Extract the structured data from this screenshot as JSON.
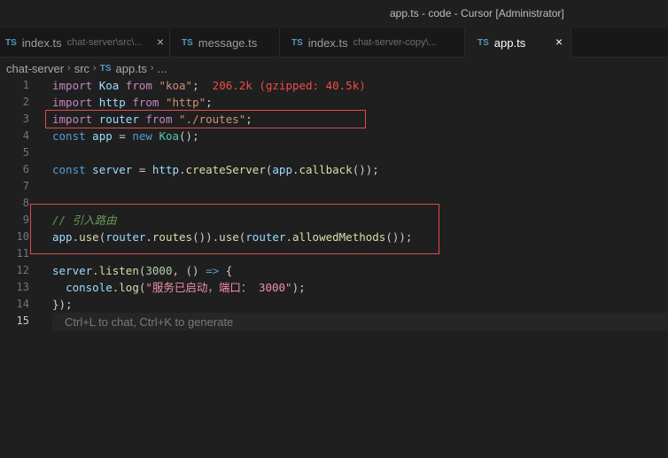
{
  "window": {
    "title": "app.ts - code - Cursor [Administrator]"
  },
  "tabs": [
    {
      "lang": "TS",
      "name": "index.ts",
      "hint": "chat-server\\src\\...",
      "close": "×",
      "active": false
    },
    {
      "lang": "TS",
      "name": "message.ts",
      "hint": "",
      "close": "",
      "active": false
    },
    {
      "lang": "TS",
      "name": "index.ts",
      "hint": "chat-server-copy\\...",
      "close": "",
      "active": false
    },
    {
      "lang": "TS",
      "name": "app.ts",
      "hint": "",
      "close": "×",
      "active": true
    }
  ],
  "breadcrumb": {
    "folder1": "chat-server",
    "folder2": "src",
    "lang": "TS",
    "file": "app.ts",
    "more": "...",
    "sep": "›"
  },
  "lines": [
    "1",
    "2",
    "3",
    "4",
    "5",
    "6",
    "7",
    "8",
    "9",
    "10",
    "11",
    "12",
    "13",
    "14",
    "15"
  ],
  "code": {
    "l1": {
      "kw": "import",
      "name": "Koa",
      "from": "from",
      "str": "\"koa\"",
      "semi": ";",
      "size": "206.2k (gzipped: 40.5k)"
    },
    "l2": {
      "kw": "import",
      "name": "http",
      "from": "from",
      "str": "\"http\"",
      "semi": ";"
    },
    "l3": {
      "kw": "import",
      "name": "router",
      "from": "from",
      "str": "\"./routes\"",
      "semi": ";"
    },
    "l4": {
      "kw": "const",
      "name": "app",
      "eq": " = ",
      "new": "new",
      "cls": "Koa",
      "rest": "();"
    },
    "l6": {
      "kw": "const",
      "name": "server",
      "eq": " = ",
      "obj": "http",
      "dot": ".",
      "fn": "createServer",
      "p1": "(",
      "arg": "app",
      "dot2": ".",
      "fn2": "callback",
      "rest": "());"
    },
    "l9": {
      "comment": "// 引入路由"
    },
    "l10": {
      "obj": "app",
      "d1": ".",
      "fn1": "use",
      "p1": "(",
      "arg": "router",
      "d2": ".",
      "fn2": "routes",
      "p2": "()).",
      "fn3": "use",
      "p3": "(",
      "arg2": "router",
      "d3": ".",
      "fn4": "allowedMethods",
      "rest": "());"
    },
    "l12": {
      "obj": "server",
      "d1": ".",
      "fn": "listen",
      "p1": "(",
      "num": "3000",
      "p2": ", () ",
      "arrow": "=>",
      "p3": " {"
    },
    "l13": {
      "indent": "  ",
      "obj": "console",
      "d1": ".",
      "fn": "log",
      "p1": "(",
      "str": "\"服务已启动，端口： 3000\"",
      "rest": ");"
    },
    "l14": {
      "text": "});"
    }
  },
  "placeholder": "Ctrl+L to chat, Ctrl+K to generate",
  "colors": {
    "highlight_border": "#e04b4b",
    "accent_ts": "#519aba"
  }
}
